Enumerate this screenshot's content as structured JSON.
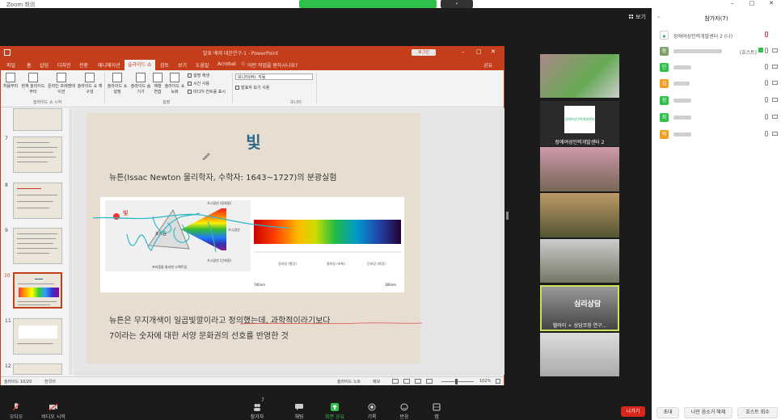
{
  "zoom": {
    "window_title": "Zoom 회의",
    "view_label": "보기",
    "share_controls_label": "⌄",
    "toolbar": {
      "audio": "오디오",
      "video": "비디오 시작",
      "participants": "참가자",
      "participants_count": "7",
      "chat": "채팅",
      "share": "화면 공유",
      "record": "기록",
      "reactions": "반응",
      "apps": "앱",
      "leave": "나가기"
    }
  },
  "participants_panel": {
    "title": "참가자(7)",
    "host_entry_name": "장애여성인력개발센터 2 (나)",
    "host_tag": "(호스트)",
    "avatars": [
      {
        "initial": "장",
        "color": "#7fa06a"
      },
      {
        "initial": "민",
        "color": "#2fbf4b"
      },
      {
        "initial": "김",
        "color": "#f0a020"
      },
      {
        "initial": "정",
        "color": "#2fbf4b"
      },
      {
        "initial": "최",
        "color": "#2fbf4b"
      },
      {
        "initial": "박",
        "color": "#f0a020"
      }
    ],
    "buttons": {
      "invite": "초대",
      "mute_me": "나만 음소거 해제",
      "claim_host": "호스트 회수"
    }
  },
  "video_tiles": {
    "center_name": "장애여성인력개발센터 2",
    "center_logo_text": "장애여성인력개발센터",
    "active_name": "헬러이 ㅅ 상담코칭 연구...",
    "active_sign": "심리상담"
  },
  "powerpoint": {
    "title": "발표 예제 대본연구-1 - PowerPoint",
    "login_label": "로그인",
    "tabs": [
      "파일",
      "홈",
      "삽입",
      "디자인",
      "전환",
      "애니메이션",
      "슬라이드 쇼",
      "검토",
      "보기",
      "도움말",
      "Acrobat"
    ],
    "active_tab": "슬라이드 쇼",
    "tell_me": "어떤 작업을 원하시나요?",
    "share_label": "공유",
    "ribbon": {
      "from_beginning": "처음부터",
      "from_current": "현재 슬라이드부터",
      "online_present": "온라인 프레젠테이션",
      "custom_show": "슬라이드 쇼 재구성",
      "setup": "슬라이드 쇼 설정",
      "hide": "슬라이드 숨기기",
      "rehearse": "예행 연습",
      "record": "슬라이드 쇼 녹화",
      "check1": "설명 재생",
      "check2": "시간 사용",
      "check3": "미디어 컨트롤 표시",
      "monitor_label": "모니터(M):",
      "monitor_value": "자동",
      "presenter_view": "발표자 보기 사용",
      "group1": "슬라이드 쇼 시작",
      "group2": "설정",
      "group3": "모니터"
    },
    "thumbs": [
      "7",
      "8",
      "9",
      "10",
      "11",
      "12"
    ],
    "slide": {
      "title": "빛",
      "subtitle": "뉴튼(Issac Newton 물리학자, 수학자: 1643~1727)의 분광실험",
      "body1": "뉴튼은 무지개색이 일곱빛깔이라고 정의했는데, 과학적이라기보다",
      "body2": "7이라는 숫자에 대한 서양 문화권의 선호를 반영한 것",
      "figure": {
        "light_label": "빛",
        "prism_label": "프리즘",
        "spectrum_caption": "프리즘을 통과한 스펙트럼",
        "visible_top": "가시광선 (장파장)",
        "visible_bottom": "가시광선 (단파장)",
        "visible_mid": "가시광선",
        "scale_left": "780nm",
        "scale_right": "380nm",
        "band1": "장파장 (빨강)",
        "band2": "중파장 (초록)",
        "band3": "단파장 (파랑)"
      }
    },
    "status": {
      "slide_info": "슬라이드 10/20",
      "language": "한국어",
      "notes": "슬라이드 노트",
      "comments": "메모",
      "zoom": "102%"
    }
  }
}
